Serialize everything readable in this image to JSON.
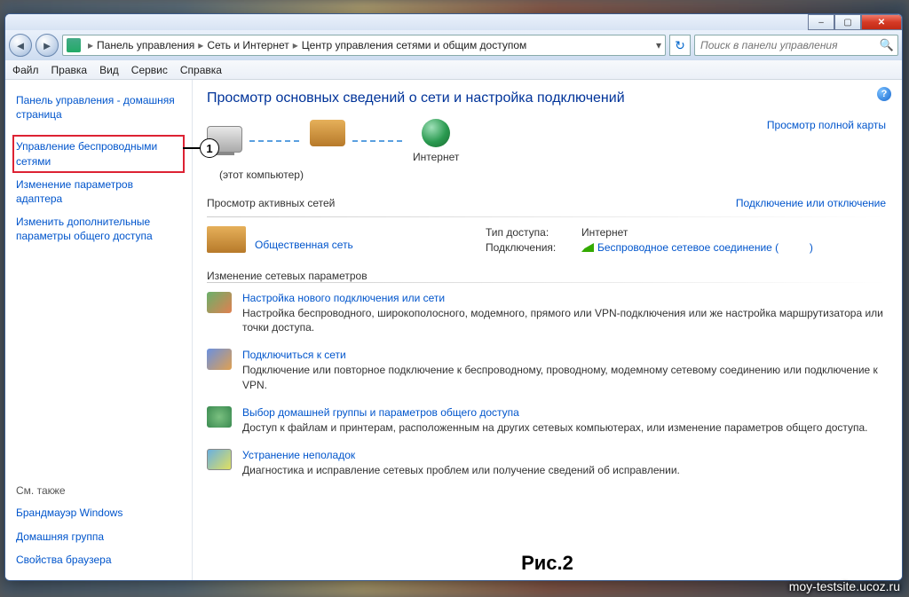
{
  "breadcrumb": {
    "root": "Панель управления",
    "l2": "Сеть и Интернет",
    "l3": "Центр управления сетями и общим доступом"
  },
  "search": {
    "placeholder": "Поиск в панели управления"
  },
  "menu": {
    "file": "Файл",
    "edit": "Правка",
    "view": "Вид",
    "service": "Сервис",
    "help": "Справка"
  },
  "sidebar": {
    "home": "Панель управления - домашняя страница",
    "wireless": "Управление беспроводными сетями",
    "adapter": "Изменение параметров адаптера",
    "sharing": "Изменить дополнительные параметры общего доступа",
    "seealso": "См. также",
    "firewall": "Брандмауэр Windows",
    "homegroup": "Домашняя группа",
    "browser": "Свойства браузера"
  },
  "main": {
    "heading": "Просмотр основных сведений о сети и настройка подключений",
    "maplink": "Просмотр полной карты",
    "thiscomp": "(этот компьютер)",
    "internet": "Интернет",
    "activeHeader": "Просмотр активных сетей",
    "connectDisconnect": "Подключение или отключение",
    "publicNet": "Общественная сеть",
    "accessTypeLabel": "Тип доступа:",
    "accessTypeValue": "Интернет",
    "connectionsLabel": "Подключения:",
    "connectionsValue": "Беспроводное сетевое соединение (",
    "connectionsTail": ")",
    "changeHeader": "Изменение сетевых параметров",
    "a1t": "Настройка нового подключения или сети",
    "a1d": "Настройка беспроводного, широкополосного, модемного, прямого или VPN-подключения или же настройка маршрутизатора или точки доступа.",
    "a2t": "Подключиться к сети",
    "a2d": "Подключение или повторное подключение к беспроводному, проводному, модемному сетевому соединению или подключение к VPN.",
    "a3t": "Выбор домашней группы и параметров общего доступа",
    "a3d": "Доступ к файлам и принтерам, расположенным на других сетевых компьютерах, или изменение параметров общего доступа.",
    "a4t": "Устранение неполадок",
    "a4d": "Диагностика и исправление сетевых проблем или получение сведений об исправлении."
  },
  "annotation": "1",
  "figure": "Рис.2",
  "watermark": "moy-testsite.ucoz.ru"
}
